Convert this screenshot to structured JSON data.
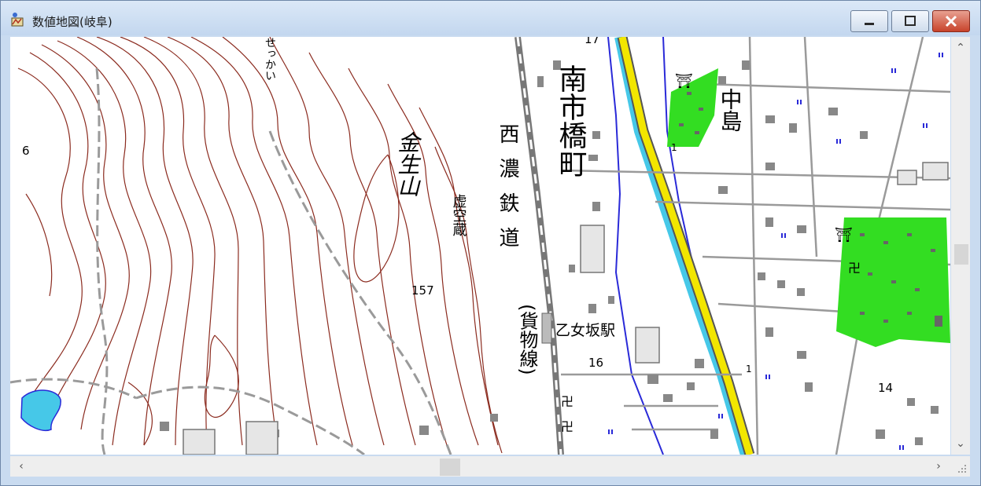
{
  "window": {
    "title": "数値地図(岐阜)"
  },
  "map": {
    "labels": {
      "town_minami_ichihashi": "南市橋町",
      "area_nakajima": "中島",
      "mountain_kinshouzan": "金生山",
      "temple_kokuzo": "虚空蔵",
      "railway_seino": "西濃鉄道",
      "railway_cargo": "(貨物線)",
      "station_otomezaka": "乙女坂駅",
      "kana_sekkai": "せっかい"
    },
    "elevations": {
      "e157": "157",
      "e16": "16",
      "e14": "14",
      "e17": "17",
      "e6": "6",
      "e1a": "1",
      "e1b": "1"
    },
    "symbols": {
      "shrine": "⛩",
      "temple": "卍"
    },
    "colors": {
      "contour": "#8b2b1f",
      "road_gray": "#8c8c8c",
      "river_blue": "#2a2ad8",
      "water_cyan": "#46c8e8",
      "road_yellow": "#f2e600",
      "forest_green": "#33dd22",
      "building": "#888888"
    }
  }
}
